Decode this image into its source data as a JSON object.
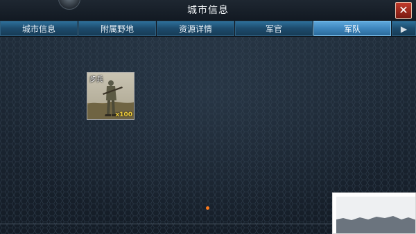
{
  "window": {
    "title": "城市信息",
    "close_label": "✕"
  },
  "tabs": [
    {
      "label": "城市信息",
      "active": false
    },
    {
      "label": "附属野地",
      "active": false
    },
    {
      "label": "资源详情",
      "active": false
    },
    {
      "label": "军官",
      "active": false
    },
    {
      "label": "军队",
      "active": true
    }
  ],
  "tabs_more_label": "▶",
  "army": {
    "units": [
      {
        "name": "步兵",
        "count": "x100"
      }
    ]
  },
  "colors": {
    "active_tab": "#3e86bd",
    "tab": "#1d4b6c",
    "close_button": "#b3301f",
    "unit_count": "#f1cf3a",
    "indicator_dot": "#ff7b1c"
  }
}
